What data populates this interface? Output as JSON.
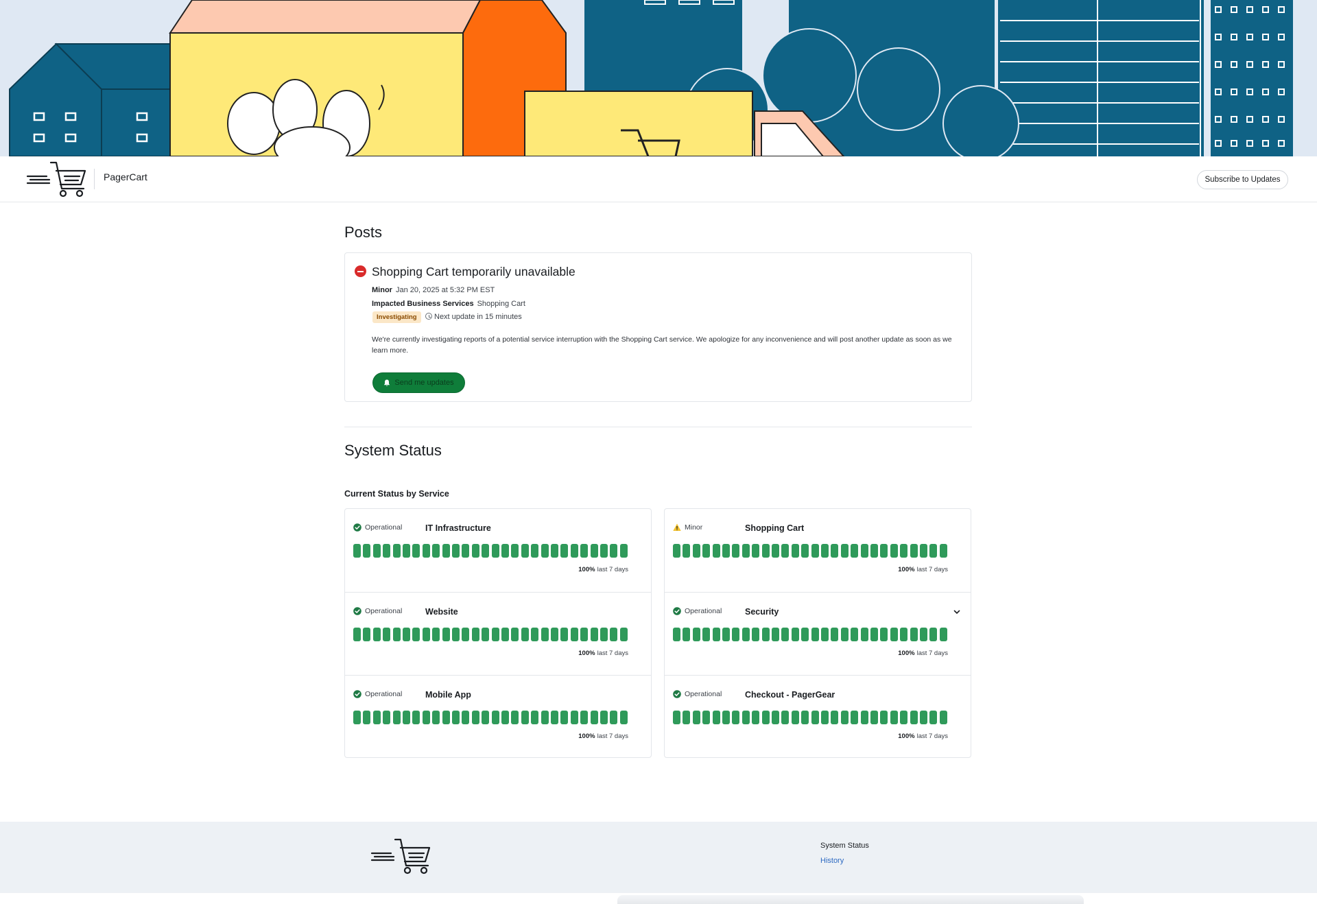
{
  "app": {
    "brand_name": "PagerCart",
    "subscribe_label": "Subscribe to Updates"
  },
  "posts": {
    "title": "Posts",
    "items": [
      {
        "title": "Shopping Cart temporarily unavailable",
        "severity": "Minor",
        "timestamp": "Jan 20, 2025 at 5:32 PM EST",
        "impacted_label": "Impacted Business Services",
        "impacted_value": "Shopping Cart",
        "state": "Investigating",
        "next_update": "Next update in 15 minutes",
        "body": "We're currently investigating reports of a potential service interruption with the Shopping Cart service. We apologize for any inconvenience and will post another update as soon as we learn more.",
        "action_label": "Send me updates"
      }
    ]
  },
  "system_status": {
    "title": "System Status",
    "subtitle": "Current Status by Service",
    "services": [
      {
        "status": "Operational",
        "name": "IT Infrastructure",
        "uptime": "100%",
        "period": "last 7 days",
        "status_color": "#1f7a45",
        "icon": "check-circle-icon"
      },
      {
        "status": "Minor",
        "name": "Shopping Cart",
        "uptime": "100%",
        "period": "last 7 days",
        "status_color": "#f2c230",
        "icon": "warning-triangle-icon"
      },
      {
        "status": "Operational",
        "name": "Website",
        "uptime": "100%",
        "period": "last 7 days",
        "status_color": "#1f7a45",
        "icon": "check-circle-icon"
      },
      {
        "status": "Operational",
        "name": "Security",
        "uptime": "100%",
        "period": "last 7 days",
        "status_color": "#1f7a45",
        "icon": "check-circle-icon",
        "expandable": true
      },
      {
        "status": "Operational",
        "name": "Mobile App",
        "uptime": "100%",
        "period": "last 7 days",
        "status_color": "#1f7a45",
        "icon": "check-circle-icon"
      },
      {
        "status": "Operational",
        "name": "Checkout - PagerGear",
        "uptime": "100%",
        "period": "last 7 days",
        "status_color": "#1f7a45",
        "icon": "check-circle-icon"
      }
    ],
    "bar_count": 28,
    "bar_color": "#2f9a5a"
  },
  "footer": {
    "nav_title": "System Status",
    "history_label": "History"
  },
  "colors": {
    "accent_green": "#0f7d3a",
    "incident_red": "#d92b2b",
    "link_blue": "#2d6ac2"
  }
}
